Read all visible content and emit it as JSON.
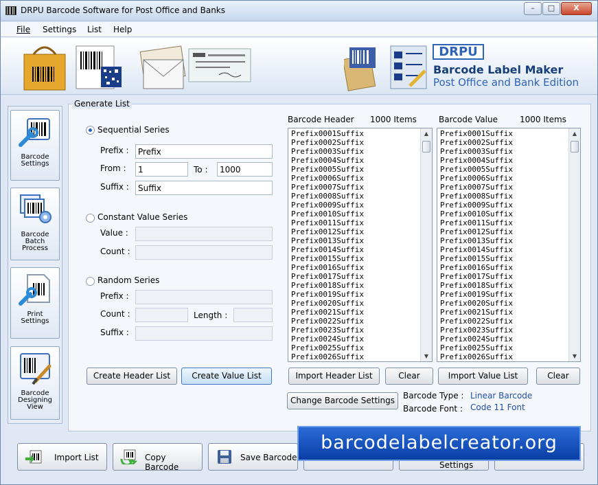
{
  "window": {
    "title": "DRPU Barcode Software for Post Office and Banks",
    "min": "–",
    "max": "□",
    "close": "X"
  },
  "menu": {
    "file": "File",
    "settings": "Settings",
    "list": "List",
    "help": "Help"
  },
  "banner": {
    "brand": "DRPU",
    "product": "Barcode Label Maker",
    "edition": "Post Office and Bank Edition"
  },
  "sidebar": [
    {
      "label": "Barcode Settings",
      "icon": "barcode-settings-icon"
    },
    {
      "label": "Barcode Batch Process",
      "icon": "batch-process-icon"
    },
    {
      "label": "Print Settings",
      "icon": "print-settings-icon"
    },
    {
      "label": "Barcode Designing View",
      "icon": "designing-view-icon"
    }
  ],
  "generate": {
    "group_title": "Generate List",
    "sequential": {
      "label": "Sequential Series",
      "prefix_label": "Prefix :",
      "prefix_value": "Prefix",
      "from_label": "From :",
      "from_value": "1",
      "to_label": "To :",
      "to_value": "1000",
      "suffix_label": "Suffix :",
      "suffix_value": "Suffix"
    },
    "constant": {
      "label": "Constant Value Series",
      "value_label": "Value :",
      "count_label": "Count :"
    },
    "random": {
      "label": "Random Series",
      "prefix_label": "Prefix :",
      "count_label": "Count :",
      "length_label": "Length :",
      "suffix_label": "Suffix :"
    },
    "create_header_button": "Create Header List",
    "create_value_button": "Create Value List"
  },
  "header_list": {
    "title": "Barcode Header",
    "count": "1000 Items",
    "import_button": "Import Header List",
    "clear_button": "Clear"
  },
  "value_list": {
    "title": "Barcode Value",
    "count": "1000 Items",
    "import_button": "Import Value List",
    "clear_button": "Clear"
  },
  "list_items": [
    "Prefix0001Suffix",
    "Prefix0002Suffix",
    "Prefix0003Suffix",
    "Prefix0004Suffix",
    "Prefix0005Suffix",
    "Prefix0006Suffix",
    "Prefix0007Suffix",
    "Prefix0008Suffix",
    "Prefix0009Suffix",
    "Prefix0010Suffix",
    "Prefix0011Suffix",
    "Prefix0012Suffix",
    "Prefix0013Suffix",
    "Prefix0014Suffix",
    "Prefix0015Suffix",
    "Prefix0016Suffix",
    "Prefix0017Suffix",
    "Prefix0018Suffix",
    "Prefix0019Suffix",
    "Prefix0020Suffix",
    "Prefix0021Suffix",
    "Prefix0022Suffix",
    "Prefix0023Suffix",
    "Prefix0024Suffix",
    "Prefix0025Suffix",
    "Prefix0026Suffix"
  ],
  "barcode_info": {
    "change_button": "Change Barcode Settings",
    "type_label": "Barcode Type :",
    "type_value": "Linear Barcode",
    "font_label": "Barcode Font :",
    "font_value": "Code 11 Font"
  },
  "bottom": {
    "import_list": "Import List",
    "copy_barcode": "Copy Barcode",
    "save_barcode": "Save Barcode",
    "settings_partial": "Settings"
  },
  "watermark": "barcodelabelcreator.org"
}
